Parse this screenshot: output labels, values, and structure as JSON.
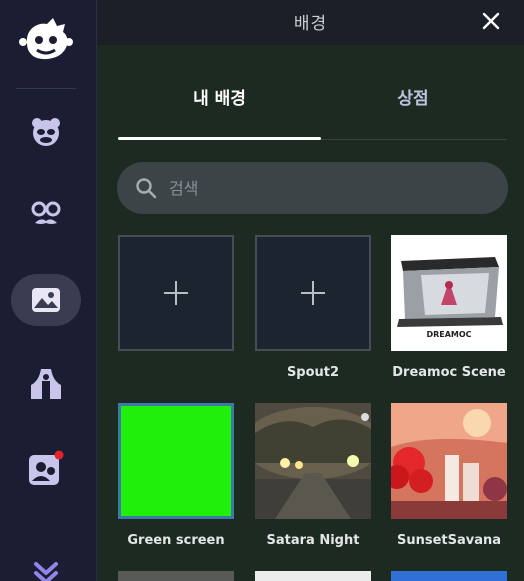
{
  "panel": {
    "title": "배경"
  },
  "tabs": [
    {
      "label": "내 배경",
      "active": true
    },
    {
      "label": "상점",
      "active": false
    }
  ],
  "search": {
    "placeholder": "검색",
    "value": ""
  },
  "tiles": [
    {
      "label": "",
      "kind": "add"
    },
    {
      "label": "Spout2",
      "kind": "add"
    },
    {
      "label": "Dreamoc Scene",
      "kind": "image",
      "caption": "DREAMOC"
    },
    {
      "label": "Green screen",
      "kind": "color",
      "color": "#1fef0a",
      "selected": true
    },
    {
      "label": "Satara Night",
      "kind": "image"
    },
    {
      "label": "SunsetSavana",
      "kind": "image"
    }
  ],
  "sidebar": {
    "items": [
      {
        "icon": "animal-avatar-icon"
      },
      {
        "icon": "face-accessory-icon"
      },
      {
        "icon": "background-image-icon",
        "active": true
      },
      {
        "icon": "stage-scene-icon"
      },
      {
        "icon": "user-notification-icon",
        "badge": true
      },
      {
        "icon": "expand-more-icon"
      }
    ]
  },
  "colors": {
    "accent": "#3d79a8",
    "sidebar": "#1b1d33",
    "panel": "#1d2a22"
  }
}
